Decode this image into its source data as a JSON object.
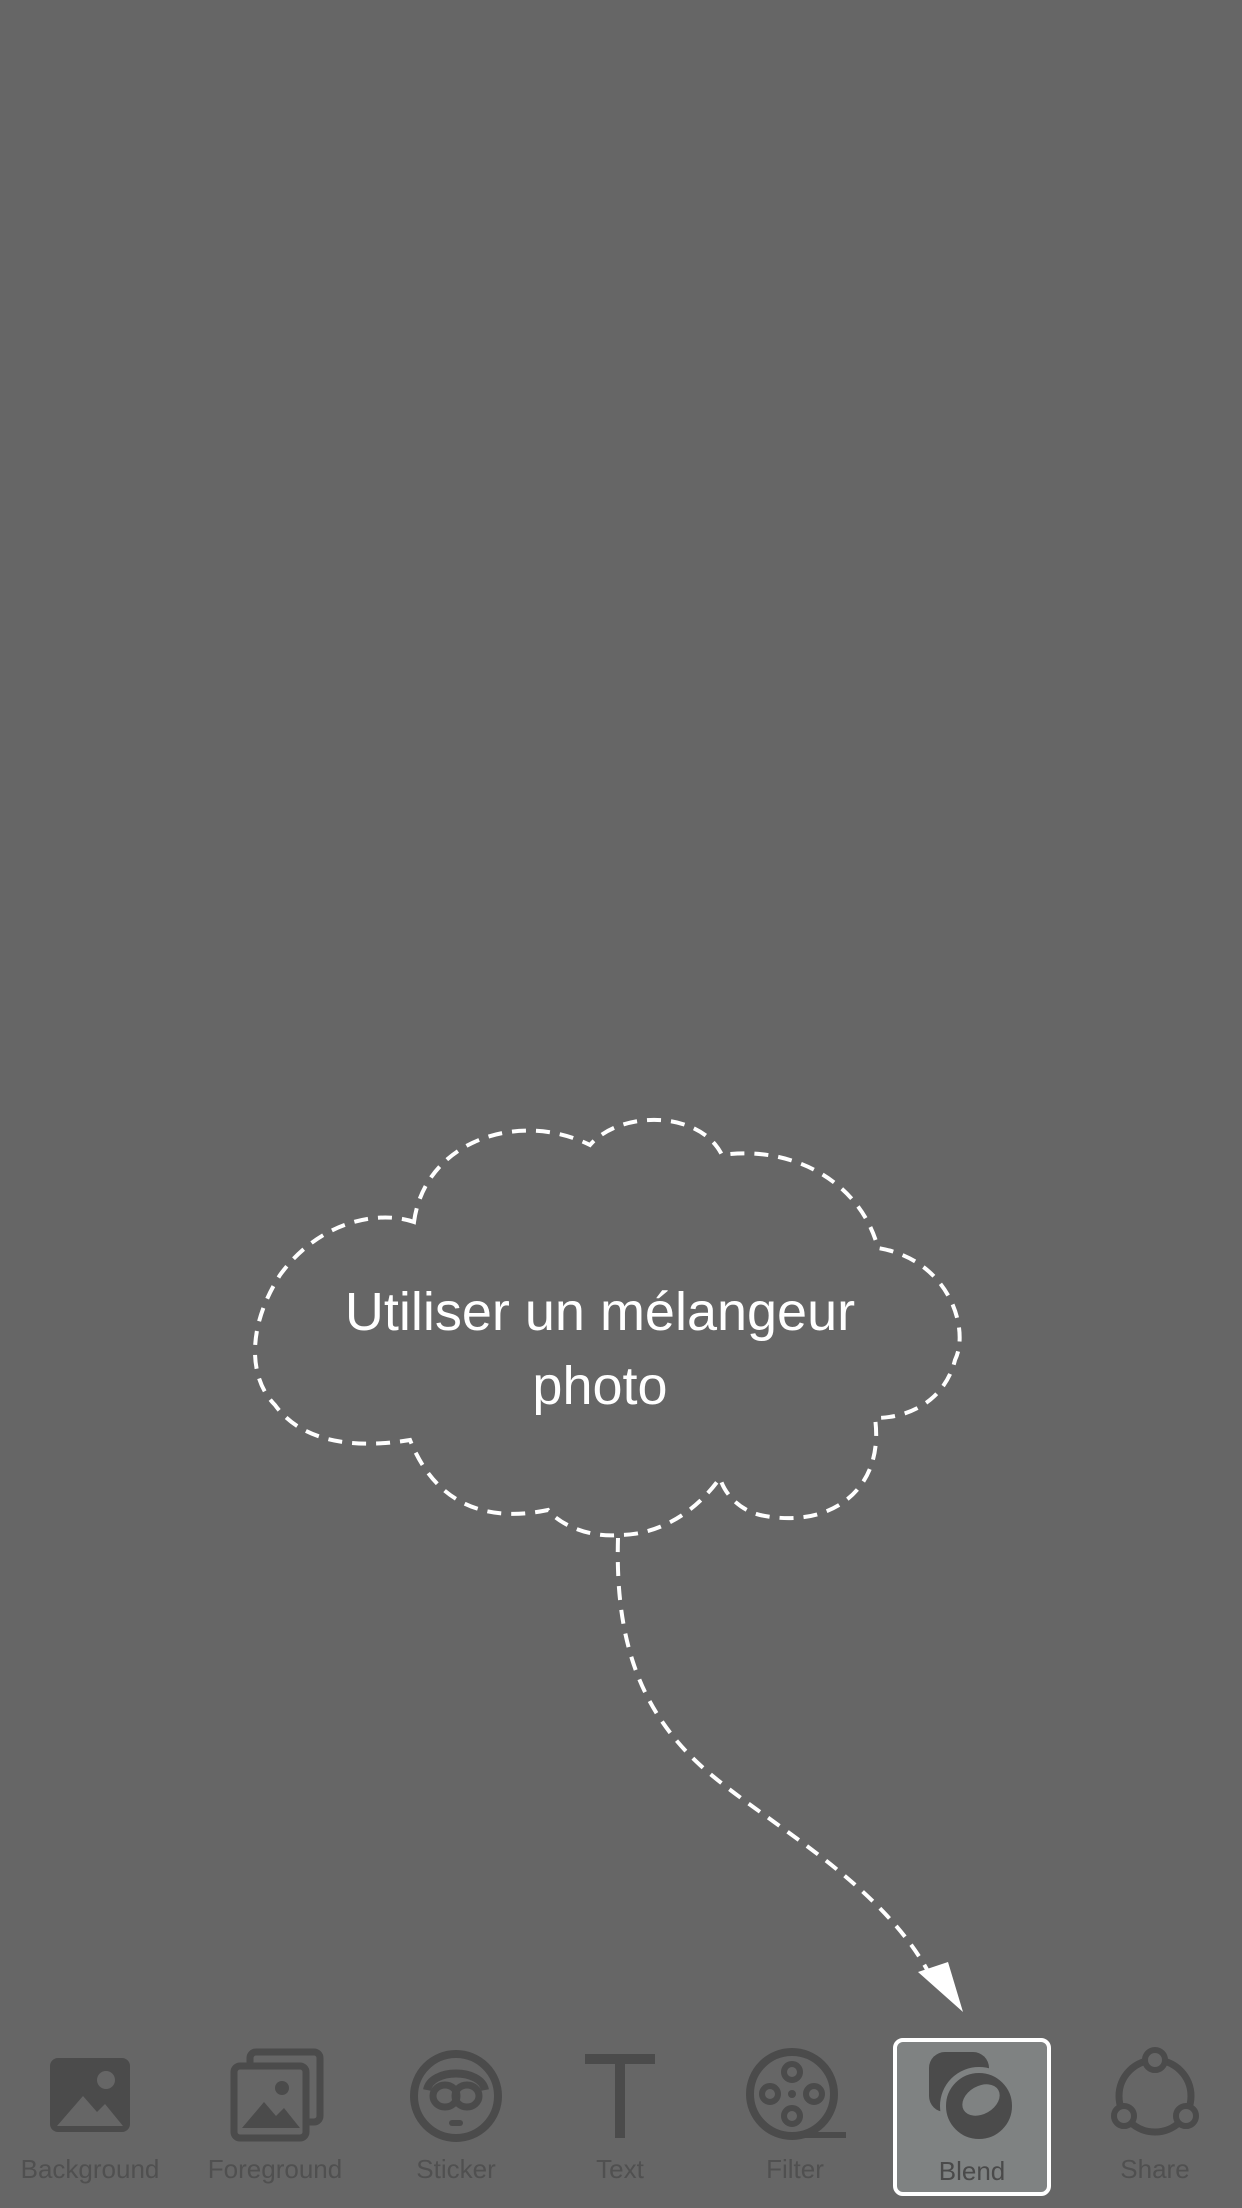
{
  "hint": {
    "line1": "Utiliser un mélangeur",
    "line2": "photo"
  },
  "toolbar": {
    "items": [
      {
        "label": "Background",
        "icon": "background-image-icon"
      },
      {
        "label": "Foreground",
        "icon": "foreground-images-icon"
      },
      {
        "label": "Sticker",
        "icon": "sticker-face-icon"
      },
      {
        "label": "Text",
        "icon": "text-t-icon"
      },
      {
        "label": "Filter",
        "icon": "film-reel-icon"
      },
      {
        "label": "Blend",
        "icon": "blend-circles-icon",
        "active": true
      },
      {
        "label": "Share",
        "icon": "share-nodes-icon"
      }
    ]
  },
  "colors": {
    "background": "#666666",
    "icon": "#4b4b4b",
    "active_bg": "#7f8282",
    "active_border": "#ffffff",
    "hint_stroke": "#ffffff"
  }
}
